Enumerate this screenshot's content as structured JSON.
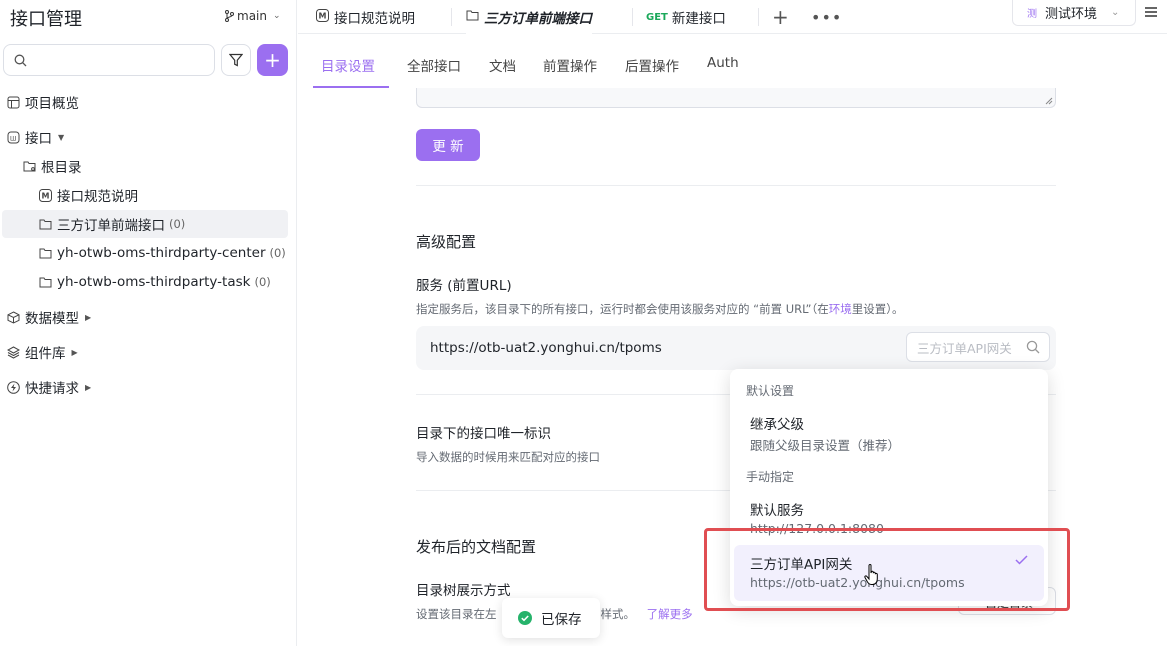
{
  "sidebar": {
    "title": "接口管理",
    "branch": "main",
    "search_placeholder": "",
    "items": [
      {
        "label": "项目概览"
      },
      {
        "label": "接口"
      },
      {
        "label": "根目录"
      },
      {
        "label": "接口规范说明"
      },
      {
        "label": "三方订单前端接口",
        "count": "(0)"
      },
      {
        "label": "yh-otwb-oms-thirdparty-center",
        "count": "(0)"
      },
      {
        "label": "yh-otwb-oms-thirdparty-task",
        "count": "(0)"
      },
      {
        "label": "数据模型"
      },
      {
        "label": "组件库"
      },
      {
        "label": "快捷请求"
      }
    ]
  },
  "tabs": [
    {
      "label": "接口规范说明"
    },
    {
      "label": "三方订单前端接口"
    },
    {
      "method": "GET",
      "label": "新建接口"
    }
  ],
  "env": {
    "badge": "测",
    "label": "测试环境"
  },
  "subtabs": [
    "目录设置",
    "全部接口",
    "文档",
    "前置操作",
    "后置操作",
    "Auth"
  ],
  "content": {
    "update_button": "更 新",
    "advanced_title": "高级配置",
    "service_label": "服务 (前置URL)",
    "service_hint_pre": "指定服务后，该目录下的所有接口，运行时都会使用该服务对应的 “前置 URL”（在",
    "service_hint_link": "环境",
    "service_hint_post": "里设置）。",
    "url_value": "https://otb-uat2.yonghui.cn/tpoms",
    "service_select": "三方订单API网关",
    "unique_id_label": "目录下的接口唯一标识",
    "unique_id_hint": "导入数据的时候用来匹配对应的接口",
    "doc_title": "发布后的文档配置",
    "tree_label": "目录树展示方式",
    "tree_hint_pre": "设置该目录在左",
    "tree_hint_post": "样式。",
    "tree_hint_link": "了解更多",
    "right_button": "自定目录"
  },
  "dropdown": {
    "group_default": "默认设置",
    "inherit_title": "继承父级",
    "inherit_desc": "跟随父级目录设置（推荐）",
    "group_manual": "手动指定",
    "default_service_title": "默认服务",
    "default_service_desc": "http://127.0.0.1:8080",
    "selected_title": "三方订单API网关",
    "selected_desc": "https://otb-uat2.yonghui.cn/tpoms"
  },
  "toast": "已保存"
}
